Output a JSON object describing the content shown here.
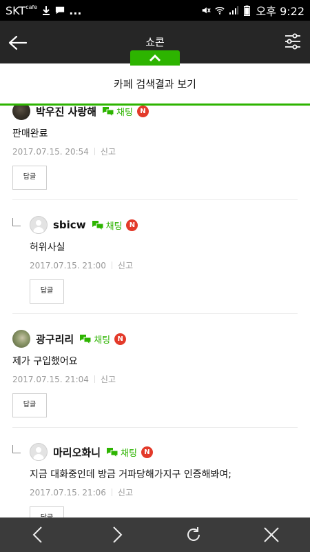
{
  "status_bar": {
    "carrier": "SKT",
    "carrier_sup": "cafe",
    "dots": "...",
    "ampm": "오후",
    "time": "9:22"
  },
  "header": {
    "title": "쇼콘",
    "back_icon": "arrow-left-icon",
    "filter_icon": "sliders-icon",
    "toggle_icon": "chevron-up-icon"
  },
  "banner": {
    "text": "카페 검색결과 보기"
  },
  "colors": {
    "accent": "#2db400",
    "header_bg": "#262626",
    "badge": "#e33a2a",
    "bottom_bar": "#3b3b3b"
  },
  "comments": [
    {
      "nickname": "박우진 사랑해",
      "chat_label": "채팅",
      "badge": "N",
      "text": "판매완료",
      "date": "2017.07.15. 20:54",
      "report": "신고",
      "reply_label": "답글"
    },
    {
      "nickname": "sbicw",
      "chat_label": "채팅",
      "badge": "N",
      "text": "허위사실",
      "date": "2017.07.15. 21:00",
      "report": "신고",
      "reply_label": "답글"
    },
    {
      "nickname": "광구리리",
      "chat_label": "채팅",
      "badge": "N",
      "text": "제가 구입했어요",
      "date": "2017.07.15. 21:04",
      "report": "신고",
      "reply_label": "답글"
    },
    {
      "nickname": "마리오화니",
      "chat_label": "채팅",
      "badge": "N",
      "text": "지금 대화중인데 방금 거파당해가지구 인증해봐여;",
      "date": "2017.07.15. 21:06",
      "report": "신고",
      "reply_label": "답글"
    }
  ],
  "bottom_nav": {
    "icons": [
      "back-icon",
      "forward-icon",
      "refresh-icon",
      "close-icon"
    ]
  }
}
